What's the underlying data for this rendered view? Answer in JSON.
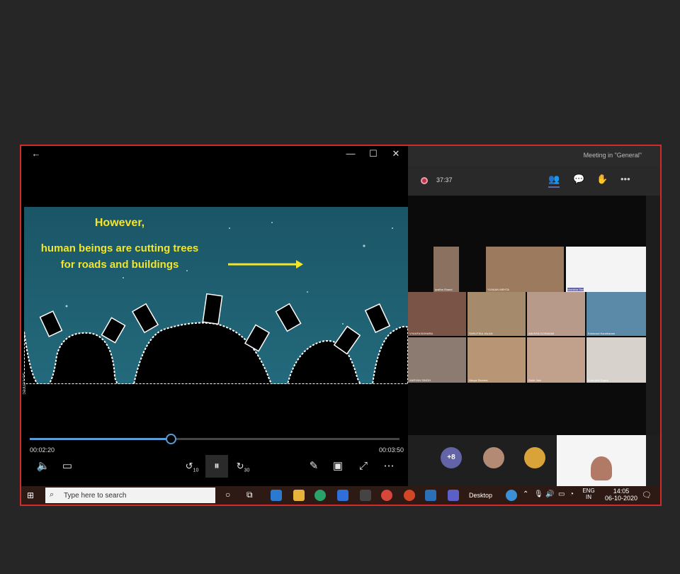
{
  "player": {
    "back_glyph": "←",
    "min_glyph": "—",
    "max_glyph": "☐",
    "close_glyph": "✕",
    "video_line1": "However,",
    "video_line2": "human beings are cutting trees",
    "video_line3": "for roads and buildings",
    "progress": 0.38,
    "elapsed": "00:02:20",
    "total": "00:03:50",
    "skip_back": "10",
    "skip_fwd": "30",
    "side_label": "screenrec"
  },
  "teams": {
    "title": "Meeting in \"General\"",
    "timer": "37:37",
    "overflow_count": "+8",
    "participants": [
      "Ipsitha Shand",
      "YUVAAN MEHTA",
      "Manisha Seri",
      "VYANTA BOHARA",
      "SHRUTIKA JALAN",
      "AAVNYA GOSWAMI",
      "Krishnavi Kandharam",
      "AARYAN SINGH",
      "Navya Sharma",
      "Sahir Jain",
      "Kumudini Gupta"
    ]
  },
  "taskbar": {
    "search_placeholder": "Type here to search",
    "desktop_label": "Desktop",
    "lang_line1": "ENG",
    "lang_line2": "IN",
    "time": "14:05",
    "date": "06-10-2020"
  },
  "colors": {
    "frame_border": "#d22a2a",
    "video_sky": "#1d5f70",
    "video_text": "#f2e52a",
    "teams_accent": "#6264a7"
  }
}
